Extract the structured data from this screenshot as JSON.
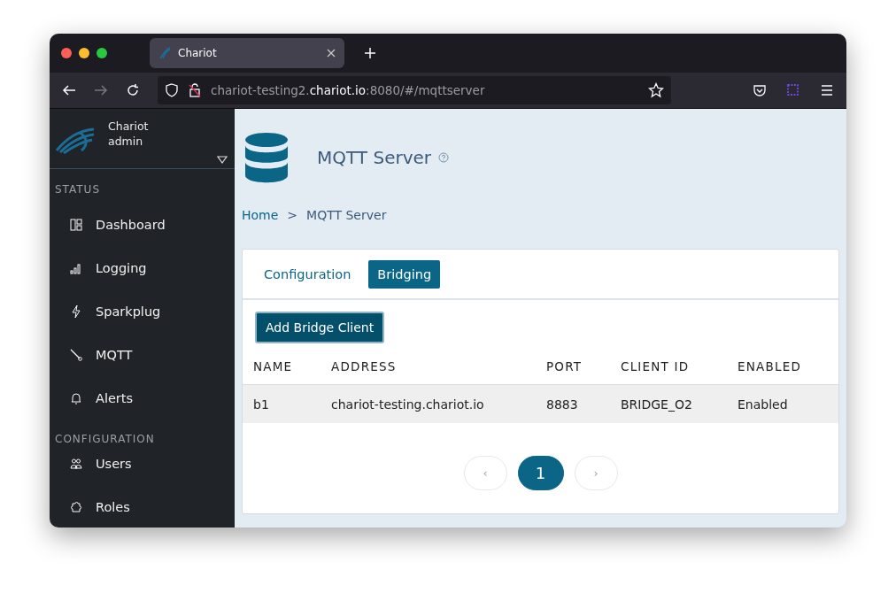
{
  "browser": {
    "tab_title": "Chariot",
    "url_prefix": "chariot-testing2.",
    "url_domain": "chariot.io",
    "url_suffix": ":8080/#/mqttserver"
  },
  "sidebar": {
    "app_name": "Chariot",
    "user": "admin",
    "items": [
      {
        "kind": "header",
        "label": "STATUS"
      },
      {
        "kind": "item",
        "label": "Dashboard",
        "selected": false
      },
      {
        "kind": "item",
        "label": "Logging",
        "selected": false
      },
      {
        "kind": "item",
        "label": "Sparkplug",
        "selected": false
      },
      {
        "kind": "item",
        "label": "MQTT",
        "selected": false
      },
      {
        "kind": "item",
        "label": "Alerts",
        "selected": false
      },
      {
        "kind": "header",
        "label": "CONFIGURATION"
      },
      {
        "kind": "item",
        "label": "Users",
        "selected": false
      },
      {
        "kind": "item",
        "label": "Roles",
        "selected": false
      }
    ]
  },
  "page": {
    "title": "MQTT Server",
    "breadcrumb": [
      {
        "label": "Home",
        "kind": "link"
      },
      {
        "label": ">",
        "kind": "sep"
      },
      {
        "label": "MQTT Server",
        "kind": "current"
      }
    ]
  },
  "tabs": [
    {
      "label": "Configuration",
      "selected": false
    },
    {
      "label": "Bridging",
      "selected": true
    }
  ],
  "add_button": "Add Bridge Client",
  "table": {
    "columns": [
      "NAME",
      "ADDRESS",
      "PORT",
      "CLIENT ID",
      "ENABLED"
    ],
    "rows": [
      [
        "b1",
        "chariot-testing.chariot.io",
        "8883",
        "BRIDGE_O2",
        "Enabled"
      ]
    ]
  },
  "pagination": [
    {
      "label": "‹",
      "kind": "prev",
      "selected": false
    },
    {
      "label": "1",
      "kind": "page",
      "selected": true
    },
    {
      "label": "›",
      "kind": "next",
      "selected": false
    }
  ]
}
